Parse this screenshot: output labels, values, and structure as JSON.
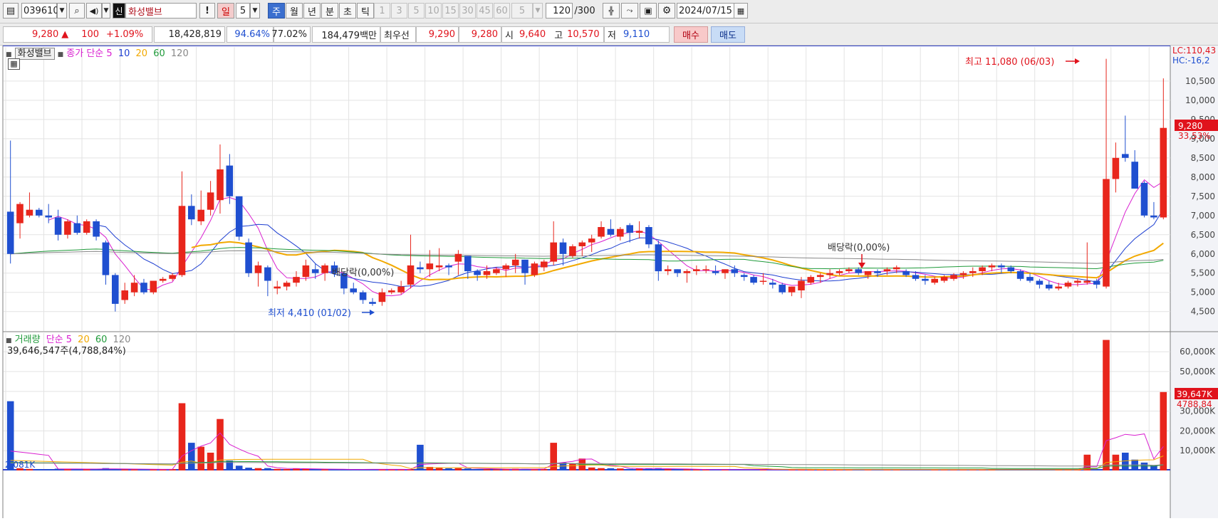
{
  "toolbar": {
    "code": "039610",
    "badge": "신",
    "stock_name": "화성밸브",
    "excl": "!",
    "period_label": "일",
    "period_value": "5",
    "tabs": [
      "주",
      "월",
      "년",
      "분",
      "초",
      "틱"
    ],
    "minute_options": [
      "1",
      "3",
      "5",
      "10",
      "15",
      "30",
      "45",
      "60"
    ],
    "tick_value": "5",
    "count_value": "120",
    "count_max": "/300",
    "date": "2024/07/15"
  },
  "quote": {
    "price": "9,280",
    "arrow": "▲",
    "change": "100",
    "change_pct": "+1.09%",
    "volume": "18,428,819",
    "vol_ratio": "94.64%",
    "ratio2": "77.02%",
    "amount": "184,479백만",
    "best_label": "최우선",
    "ask": "9,290",
    "bid": "9,280",
    "open_label": "시",
    "open": "9,640",
    "high_label": "고",
    "high": "10,570",
    "low_label": "저",
    "low": "9,110",
    "buy": "매수",
    "sell": "매도"
  },
  "price_panel": {
    "name": "화성밸브",
    "legend_prefix": "종가 단순",
    "ma_labels": [
      "5",
      "10",
      "20",
      "60",
      "120"
    ],
    "ma_colors": [
      "#d91fd0",
      "#1e3fd1",
      "#f2a900",
      "#1f9a3a",
      "#888888"
    ],
    "lc": "LC:110,43",
    "hc": "HC:-16,2",
    "price_tag": "9,280",
    "pct_tag": "33,53%",
    "max_annotation": "최고 11,080 (06/03)",
    "min_annotation": "최저 4,410 (01/02)",
    "dividend_1": "배당락(0,00%)",
    "dividend_2": "배당락(0,00%)"
  },
  "volume_panel": {
    "name": "거래량",
    "legend_prefix": "단순",
    "ma_labels": [
      "5",
      "20",
      "60",
      "120"
    ],
    "ma_colors": [
      "#d91fd0",
      "#f2a900",
      "#1f9a3a",
      "#888888"
    ],
    "value_label": "39,646,547주(4,788,84%)",
    "vol_tag": "39,647K",
    "pct_tag": "4788,84",
    "low_label": "2,081K"
  },
  "chart_data": [
    {
      "type": "candlestick",
      "y_ticks": [
        "10,500",
        "10,000",
        "9,500",
        "9,000",
        "8,500",
        "8,000",
        "7,500",
        "7,000",
        "6,500",
        "6,000",
        "5,500",
        "5,000",
        "4,500"
      ],
      "ylim": [
        4050,
        11350
      ],
      "up_color": "#e8261c",
      "down_color": "#1f4fd0",
      "ohlc": [
        [
          7100,
          8950,
          5750,
          6000
        ],
        [
          6800,
          7350,
          6400,
          7300
        ],
        [
          7000,
          7600,
          6950,
          7150
        ],
        [
          7150,
          7200,
          6950,
          7000
        ],
        [
          7000,
          7300,
          6800,
          6950
        ],
        [
          6950,
          7150,
          6350,
          6500
        ],
        [
          6500,
          6900,
          6400,
          6850
        ],
        [
          6800,
          7000,
          6500,
          6550
        ],
        [
          6550,
          6900,
          6500,
          6850
        ],
        [
          6850,
          6900,
          6350,
          6450
        ],
        [
          6300,
          6350,
          5200,
          5450
        ],
        [
          5450,
          5500,
          4500,
          4700
        ],
        [
          4800,
          5250,
          4700,
          5050
        ],
        [
          5000,
          5450,
          4900,
          5250
        ],
        [
          5250,
          5350,
          4950,
          5000
        ],
        [
          5000,
          5300,
          4950,
          5300
        ],
        [
          5300,
          5400,
          5250,
          5350
        ],
        [
          5350,
          5500,
          5300,
          5450
        ],
        [
          5450,
          8150,
          5400,
          7250
        ],
        [
          7250,
          7550,
          6750,
          6900
        ],
        [
          6850,
          7650,
          6750,
          7150
        ],
        [
          7150,
          7900,
          7000,
          7600
        ],
        [
          7400,
          8850,
          7050,
          8200
        ],
        [
          8300,
          8600,
          7300,
          7500
        ],
        [
          7500,
          7500,
          6350,
          6450
        ],
        [
          6300,
          6400,
          5400,
          5500
        ],
        [
          5500,
          5800,
          5150,
          5700
        ],
        [
          5650,
          5700,
          4900,
          5300
        ],
        [
          5100,
          5300,
          4950,
          5150
        ],
        [
          5150,
          5300,
          5050,
          5250
        ],
        [
          5250,
          5550,
          5150,
          5400
        ],
        [
          5400,
          5850,
          5300,
          5700
        ],
        [
          5600,
          5750,
          5350,
          5500
        ],
        [
          5500,
          5750,
          5300,
          5700
        ],
        [
          5700,
          5800,
          5400,
          5500
        ],
        [
          5500,
          5550,
          4950,
          5100
        ],
        [
          5100,
          5250,
          4950,
          5000
        ],
        [
          5000,
          5050,
          4700,
          4800
        ],
        [
          4750,
          4850,
          4650,
          4700
        ],
        [
          4750,
          5100,
          4650,
          5000
        ],
        [
          5000,
          5100,
          4950,
          5050
        ],
        [
          5000,
          5300,
          4950,
          5150
        ],
        [
          5200,
          6500,
          5100,
          5700
        ],
        [
          5650,
          5800,
          5500,
          5600
        ],
        [
          5600,
          6100,
          5400,
          5750
        ],
        [
          5650,
          6150,
          5550,
          5700
        ],
        [
          5700,
          5750,
          5450,
          5650
        ],
        [
          5800,
          6100,
          5450,
          6000
        ],
        [
          5950,
          5950,
          5350,
          5550
        ],
        [
          5550,
          5600,
          5300,
          5450
        ],
        [
          5450,
          5700,
          5350,
          5550
        ],
        [
          5500,
          5650,
          5450,
          5600
        ],
        [
          5600,
          5750,
          5400,
          5700
        ],
        [
          5700,
          6000,
          5500,
          5850
        ],
        [
          5850,
          5850,
          5200,
          5500
        ],
        [
          5450,
          5800,
          5400,
          5750
        ],
        [
          5650,
          5850,
          5550,
          5800
        ],
        [
          5800,
          6850,
          5700,
          6300
        ],
        [
          6300,
          6400,
          5700,
          6000
        ],
        [
          5950,
          6250,
          5900,
          6200
        ],
        [
          6200,
          6350,
          5950,
          6300
        ],
        [
          6300,
          6500,
          6050,
          6400
        ],
        [
          6450,
          6850,
          6400,
          6700
        ],
        [
          6650,
          6900,
          6450,
          6500
        ],
        [
          6450,
          6700,
          6350,
          6650
        ],
        [
          6750,
          6800,
          6300,
          6550
        ],
        [
          6550,
          6850,
          6400,
          6600
        ],
        [
          6700,
          6750,
          6150,
          6250
        ],
        [
          6250,
          6350,
          5300,
          5550
        ],
        [
          5550,
          5700,
          5450,
          5600
        ],
        [
          5600,
          5600,
          5400,
          5500
        ],
        [
          5500,
          5600,
          5250,
          5550
        ],
        [
          5550,
          5700,
          5450,
          5600
        ],
        [
          5600,
          5700,
          5500,
          5600
        ],
        [
          5550,
          5700,
          5450,
          5500
        ],
        [
          5500,
          5600,
          5350,
          5600
        ],
        [
          5600,
          5700,
          5400,
          5500
        ],
        [
          5450,
          5500,
          5300,
          5400
        ],
        [
          5400,
          5450,
          5200,
          5250
        ],
        [
          5300,
          5500,
          5200,
          5300
        ],
        [
          5250,
          5350,
          5100,
          5200
        ],
        [
          5200,
          5250,
          4950,
          5000
        ],
        [
          5000,
          5150,
          4900,
          5150
        ],
        [
          5050,
          5400,
          4850,
          5300
        ],
        [
          5250,
          5450,
          5200,
          5400
        ],
        [
          5400,
          5500,
          5250,
          5450
        ],
        [
          5450,
          5600,
          5350,
          5500
        ],
        [
          5500,
          5600,
          5450,
          5550
        ],
        [
          5550,
          5650,
          5500,
          5600
        ],
        [
          5600,
          5650,
          5450,
          5500
        ],
        [
          5450,
          5550,
          5350,
          5550
        ],
        [
          5550,
          5600,
          5400,
          5500
        ],
        [
          5550,
          5650,
          5450,
          5600
        ],
        [
          5600,
          5700,
          5500,
          5650
        ],
        [
          5550,
          5600,
          5400,
          5450
        ],
        [
          5450,
          5550,
          5300,
          5350
        ],
        [
          5350,
          5450,
          5200,
          5300
        ],
        [
          5250,
          5400,
          5200,
          5350
        ],
        [
          5300,
          5450,
          5250,
          5400
        ],
        [
          5350,
          5500,
          5300,
          5450
        ],
        [
          5450,
          5550,
          5350,
          5500
        ],
        [
          5500,
          5650,
          5400,
          5550
        ],
        [
          5550,
          5700,
          5450,
          5650
        ],
        [
          5650,
          5750,
          5550,
          5700
        ],
        [
          5700,
          5750,
          5500,
          5650
        ],
        [
          5650,
          5700,
          5500,
          5550
        ],
        [
          5550,
          5600,
          5300,
          5350
        ],
        [
          5400,
          5500,
          5250,
          5300
        ],
        [
          5300,
          5350,
          5100,
          5200
        ],
        [
          5200,
          5300,
          5050,
          5100
        ],
        [
          5100,
          5250,
          5050,
          5150
        ],
        [
          5150,
          5300,
          5100,
          5250
        ],
        [
          5250,
          5350,
          5150,
          5300
        ],
        [
          5250,
          6300,
          5200,
          5300
        ],
        [
          5300,
          5350,
          5100,
          5200
        ],
        [
          5150,
          11080,
          5100,
          7950
        ],
        [
          7950,
          8900,
          7600,
          8500
        ],
        [
          8600,
          9600,
          8400,
          8500
        ],
        [
          8400,
          8700,
          7750,
          7700
        ],
        [
          7850,
          7900,
          6950,
          7000
        ],
        [
          7000,
          7350,
          6900,
          6950
        ],
        [
          6950,
          10570,
          6900,
          9280
        ]
      ]
    },
    {
      "type": "bar",
      "y_ticks": [
        "60,000K",
        "50,000K",
        "40,000K",
        "30,000K",
        "20,000K",
        "10,000K"
      ],
      "ylim": [
        0,
        68000
      ],
      "unit": "K",
      "values": [
        35000,
        1100,
        800,
        700,
        600,
        900,
        800,
        700,
        600,
        600,
        1200,
        800,
        500,
        500,
        500,
        700,
        600,
        700,
        34000,
        14000,
        12000,
        9000,
        26000,
        5000,
        2400,
        1400,
        1200,
        1200,
        800,
        700,
        900,
        900,
        600,
        500,
        500,
        500,
        500,
        700,
        600,
        600,
        500,
        500,
        500,
        13000,
        1800,
        1500,
        1100,
        1200,
        1000,
        700,
        600,
        500,
        600,
        900,
        800,
        600,
        700,
        14000,
        4000,
        3500,
        6000,
        1500,
        1200,
        1100,
        1000,
        800,
        900,
        1000,
        1200,
        600,
        500,
        500,
        500,
        500,
        400,
        500,
        400,
        400,
        400,
        400,
        400,
        400,
        600,
        600,
        500,
        400,
        400,
        400,
        400,
        400,
        400,
        400,
        400,
        400,
        400,
        400,
        400,
        400,
        400,
        400,
        400,
        400,
        400,
        400,
        400,
        400,
        400,
        400,
        400,
        400,
        400,
        400,
        400,
        8000,
        400,
        66000,
        8000,
        9000,
        5500,
        4000,
        2500,
        39647
      ]
    }
  ]
}
